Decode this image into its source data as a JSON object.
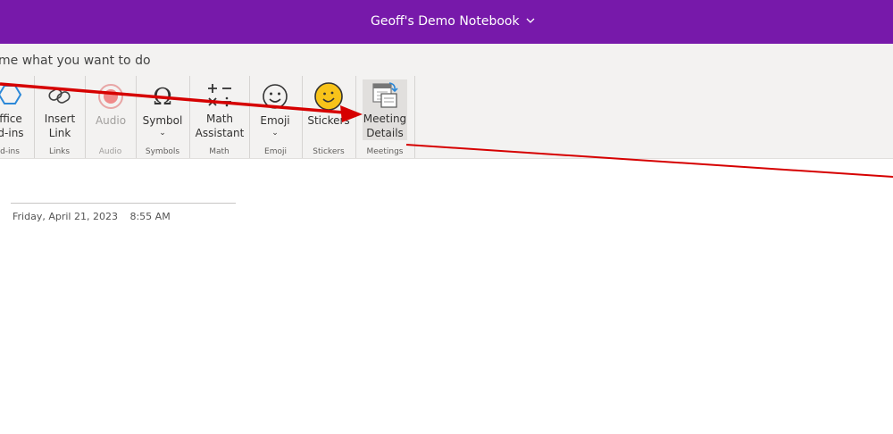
{
  "titlebar": {
    "notebook_name": "Geoff's Demo Notebook",
    "chevron": "chevron-down-icon"
  },
  "search": {
    "text": "me what you want to do"
  },
  "ribbon": {
    "groups": [
      {
        "label": "d-ins",
        "buttons": [
          {
            "line1": "ffice",
            "line2": "d-ins",
            "icon": "office-addins-icon"
          }
        ]
      },
      {
        "label": "Links",
        "buttons": [
          {
            "line1": "Insert",
            "line2": "Link",
            "icon": "link-icon"
          }
        ]
      },
      {
        "label": "Audio",
        "buttons": [
          {
            "line1": "Audio",
            "icon": "record-icon",
            "disabled": true
          }
        ]
      },
      {
        "label": "Symbols",
        "buttons": [
          {
            "line1": "Symbol",
            "caret": "⌄",
            "icon": "omega-icon"
          }
        ]
      },
      {
        "label": "Math",
        "buttons": [
          {
            "line1": "Math",
            "line2": "Assistant",
            "icon": "math-icon"
          }
        ]
      },
      {
        "label": "Emoji",
        "buttons": [
          {
            "line1": "Emoji",
            "caret": "⌄",
            "icon": "smiley-icon"
          }
        ]
      },
      {
        "label": "Stickers",
        "buttons": [
          {
            "line1": "Stickers",
            "icon": "sticker-icon"
          }
        ]
      },
      {
        "label": "Meetings",
        "buttons": [
          {
            "line1": "Meeting",
            "line2": "Details",
            "icon": "meeting-calendar-icon"
          }
        ]
      }
    ]
  },
  "page": {
    "date": "Friday, April 21, 2023",
    "time": "8:55 AM"
  },
  "colors": {
    "brand": "#7719aa",
    "annotation": "#d60000",
    "sticker": "#f7c31a"
  }
}
